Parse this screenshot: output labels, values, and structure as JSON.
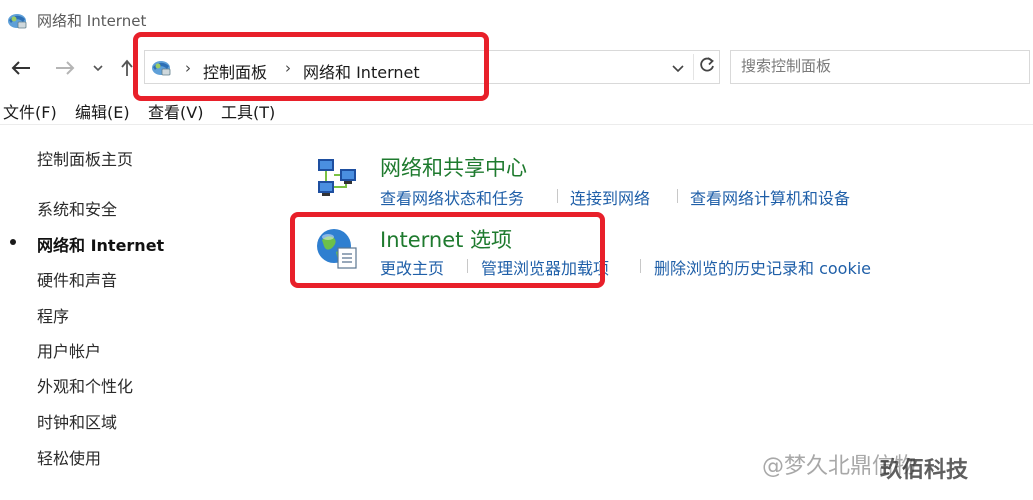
{
  "window": {
    "title": "网络和 Internet"
  },
  "nav": {
    "back_icon": "back-arrow-icon",
    "forward_icon": "forward-arrow-icon",
    "recent_icon": "chevron-down-icon",
    "up_icon": "up-arrow-icon"
  },
  "address": {
    "crumbs": [
      "控制面板",
      "网络和 Internet"
    ],
    "refresh_icon": "refresh-icon"
  },
  "search": {
    "placeholder": "搜索控制面板"
  },
  "menu": {
    "items": [
      "文件(F)",
      "编辑(E)",
      "查看(V)",
      "工具(T)"
    ]
  },
  "sidebar": {
    "items": [
      {
        "label": "控制面板主页",
        "active": false
      },
      {
        "label": "系统和安全",
        "active": false
      },
      {
        "label": "网络和 Internet",
        "active": true
      },
      {
        "label": "硬件和声音",
        "active": false
      },
      {
        "label": "程序",
        "active": false
      },
      {
        "label": "用户帐户",
        "active": false
      },
      {
        "label": "外观和个性化",
        "active": false
      },
      {
        "label": "时钟和区域",
        "active": false
      },
      {
        "label": "轻松使用",
        "active": false
      }
    ]
  },
  "categories": [
    {
      "title": "网络和共享中心",
      "icon": "network-sharing-center-icon",
      "tasks": [
        "查看网络状态和任务",
        "连接到网络",
        "查看网络计算机和设备"
      ]
    },
    {
      "title": "Internet 选项",
      "icon": "internet-options-globe-icon",
      "tasks": [
        "更改主页",
        "管理浏览器加载项",
        "删除浏览的历史记录和 cookie"
      ]
    }
  ],
  "watermark": {
    "text": "@梦久北鼎信物",
    "overlay": "玖佰科技"
  },
  "colors": {
    "highlight": "#e8202a",
    "category_title": "#1e7a2e",
    "link": "#1f5fa8"
  }
}
